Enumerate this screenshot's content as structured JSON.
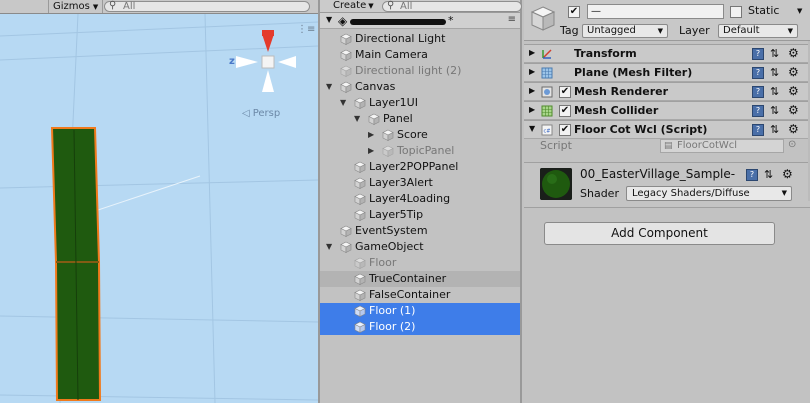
{
  "scene": {
    "gizmos_label": "Gizmos",
    "search_placeholder": "All",
    "persp_label": "Persp",
    "axis_z": "z",
    "axis_x": "x"
  },
  "hierarchy": {
    "create_label": "Create",
    "search_placeholder": "All",
    "scene_suffix": "*",
    "items": [
      {
        "label": "Directional Light",
        "indent": 0,
        "fold": "",
        "state": "normal"
      },
      {
        "label": "Main Camera",
        "indent": 0,
        "fold": "",
        "state": "normal"
      },
      {
        "label": "Directional light (2)",
        "indent": 0,
        "fold": "",
        "state": "dim"
      },
      {
        "label": "Canvas",
        "indent": 0,
        "fold": "open",
        "state": "normal"
      },
      {
        "label": "Layer1UI",
        "indent": 1,
        "fold": "open",
        "state": "normal"
      },
      {
        "label": "Panel",
        "indent": 2,
        "fold": "open",
        "state": "normal"
      },
      {
        "label": "Score",
        "indent": 3,
        "fold": "closed",
        "state": "normal"
      },
      {
        "label": "TopicPanel",
        "indent": 3,
        "fold": "closed",
        "state": "dim"
      },
      {
        "label": "Layer2POPPanel",
        "indent": 1,
        "fold": "",
        "state": "normal"
      },
      {
        "label": "Layer3Alert",
        "indent": 1,
        "fold": "",
        "state": "normal"
      },
      {
        "label": "Layer4Loading",
        "indent": 1,
        "fold": "",
        "state": "normal"
      },
      {
        "label": "Layer5Tip",
        "indent": 1,
        "fold": "",
        "state": "normal"
      },
      {
        "label": "EventSystem",
        "indent": 0,
        "fold": "",
        "state": "normal"
      },
      {
        "label": "GameObject",
        "indent": 0,
        "fold": "open",
        "state": "normal"
      },
      {
        "label": "Floor",
        "indent": 1,
        "fold": "",
        "state": "dim"
      },
      {
        "label": "TrueContainer",
        "indent": 1,
        "fold": "",
        "state": "hover"
      },
      {
        "label": "FalseContainer",
        "indent": 1,
        "fold": "",
        "state": "normal"
      },
      {
        "label": "Floor (1)",
        "indent": 1,
        "fold": "",
        "state": "selected"
      },
      {
        "label": "Floor (2)",
        "indent": 1,
        "fold": "",
        "state": "selected"
      }
    ]
  },
  "inspector": {
    "name_value": "—",
    "static_label": "Static",
    "tag_label": "Tag",
    "tag_value": "Untagged",
    "layer_label": "Layer",
    "layer_value": "Default",
    "components": [
      {
        "title": "Transform",
        "has_check": false,
        "icon": "transform-icon"
      },
      {
        "title": "Plane (Mesh Filter)",
        "has_check": false,
        "icon": "mesh-filter-icon"
      },
      {
        "title": "Mesh Renderer",
        "has_check": true,
        "icon": "mesh-renderer-icon"
      },
      {
        "title": "Mesh Collider",
        "has_check": true,
        "icon": "mesh-collider-icon"
      },
      {
        "title": "Floor Cot Wcl (Script)",
        "has_check": true,
        "icon": "script-icon",
        "expanded": true
      }
    ],
    "script_label": "Script",
    "script_value": "FloorCotWcl",
    "material_name": "00_EasterVillage_Sample-",
    "shader_label": "Shader",
    "shader_value": "Legacy Shaders/Diffuse",
    "add_component_label": "Add Component"
  },
  "colors": {
    "scene_bg": "#b7d9f3",
    "selection": "#3e7de9",
    "floor_green": "#1f5a0f",
    "outline_orange": "#f07a1c"
  }
}
